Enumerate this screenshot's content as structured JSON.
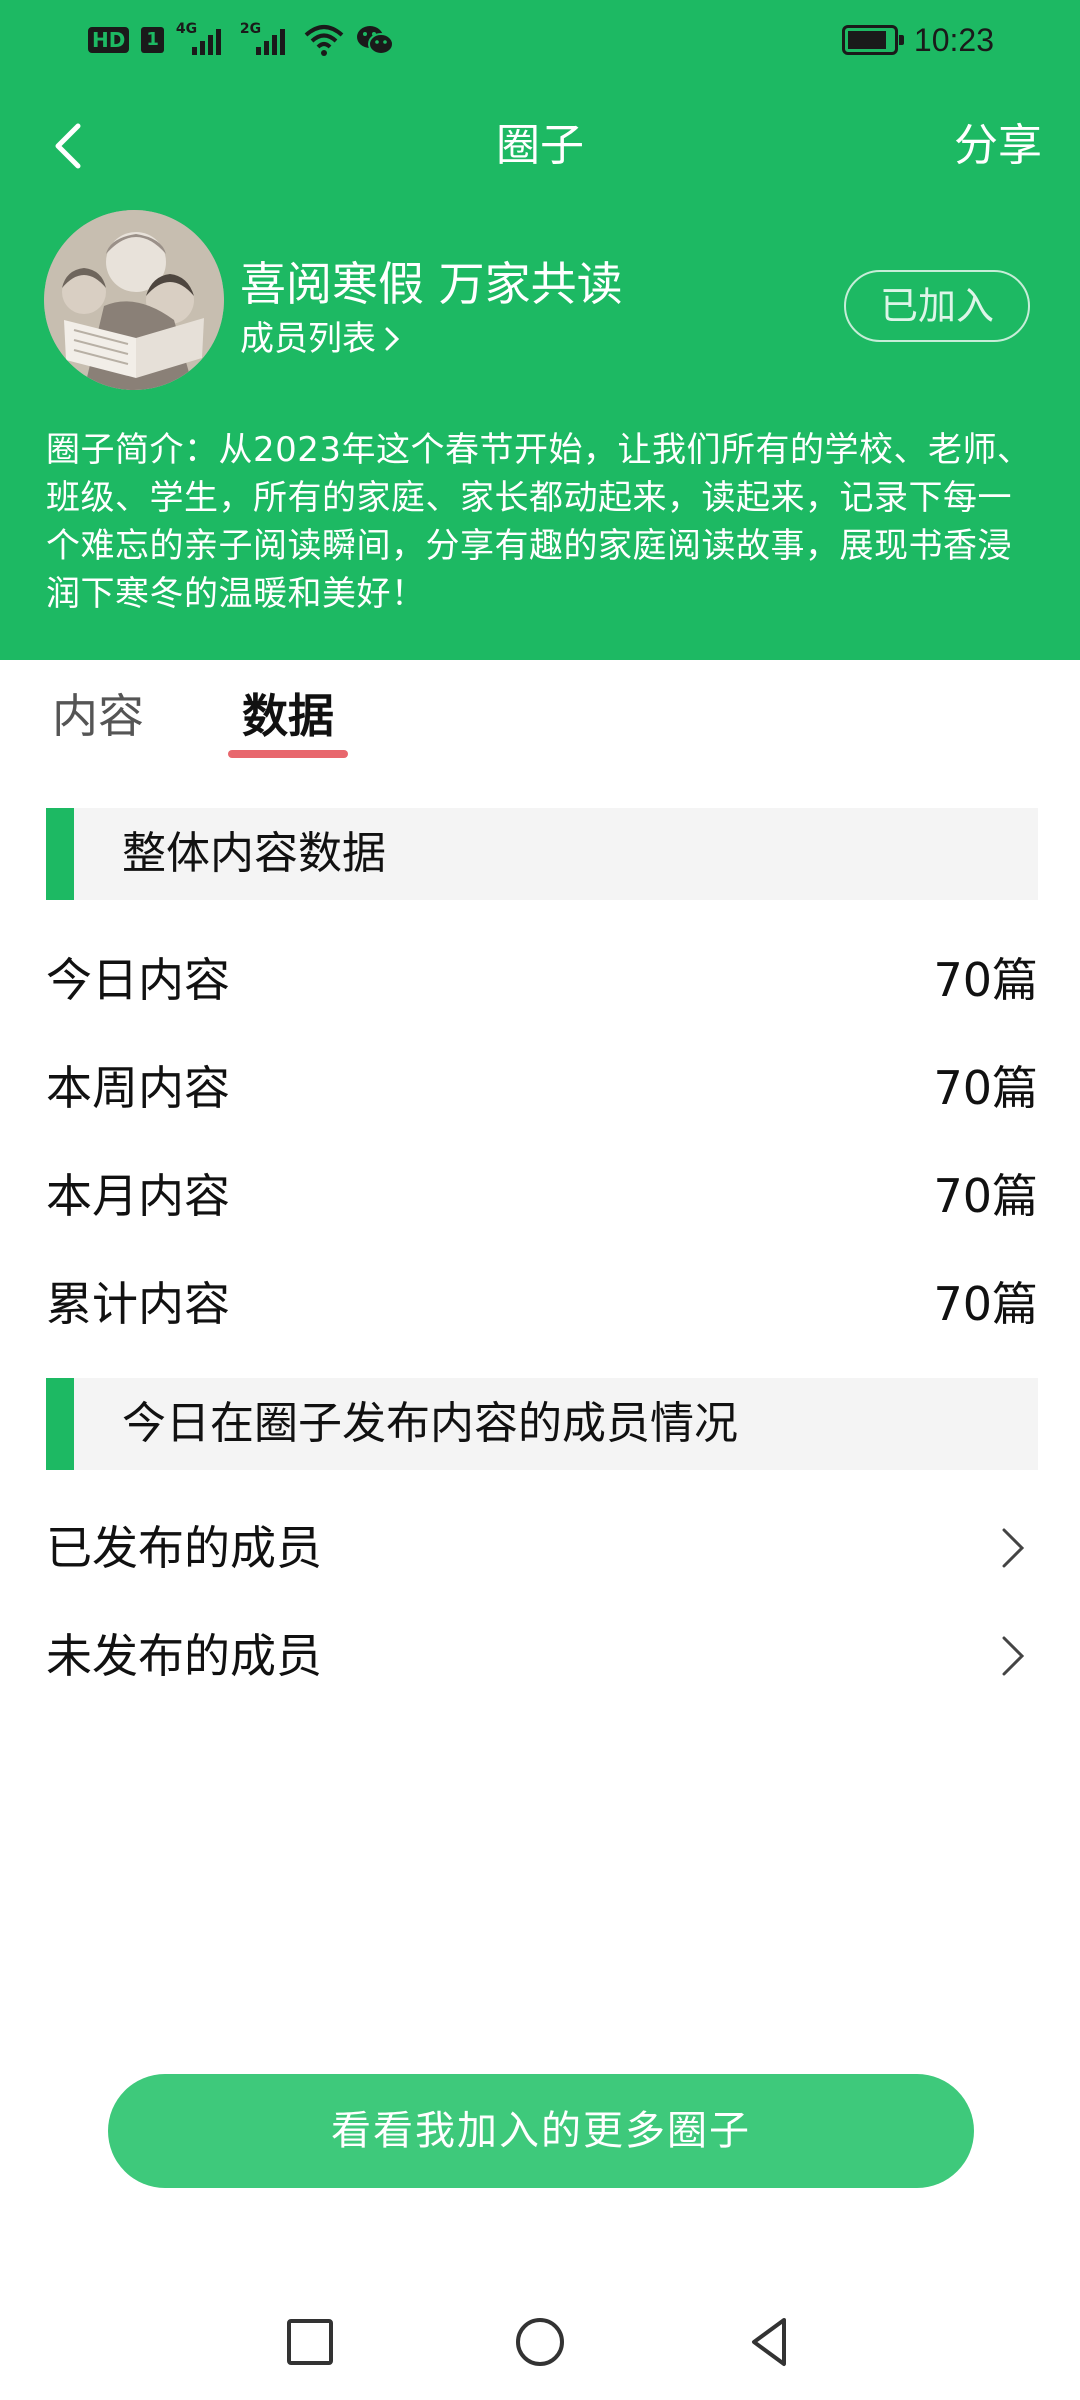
{
  "status_bar": {
    "hd_label": "HD",
    "sim_label": "1",
    "signal1_label": "4G",
    "signal2_label": "2G",
    "wifi_icon": "wifi-icon",
    "wechat_icon": "wechat-icon",
    "time": "10:23"
  },
  "navbar": {
    "title": "圈子",
    "share_label": "分享"
  },
  "group": {
    "name": "喜阅寒假 万家共读",
    "member_list_label": "成员列表",
    "joined_label": "已加入",
    "intro": "圈子简介：从2023年这个春节开始，让我们所有的学校、老师、班级、学生，所有的家庭、家长都动起来，读起来，记录下每一个难忘的亲子阅读瞬间，分享有趣的家庭阅读故事，展现书香浸润下寒冬的温暖和美好！"
  },
  "tabs": [
    {
      "label": "内容",
      "active": false
    },
    {
      "label": "数据",
      "active": true
    }
  ],
  "stats_section": {
    "title": "整体内容数据",
    "rows": [
      {
        "label": "今日内容",
        "value": "70篇"
      },
      {
        "label": "本周内容",
        "value": "70篇"
      },
      {
        "label": "本月内容",
        "value": "70篇"
      },
      {
        "label": "累计内容",
        "value": "70篇"
      }
    ]
  },
  "members_section": {
    "title": "今日在圈子发布内容的成员情况",
    "rows": [
      {
        "label": "已发布的成员"
      },
      {
        "label": "未发布的成员"
      }
    ]
  },
  "more_button_label": "看看我加入的更多圈子",
  "colors": {
    "primary_green": "#1db963",
    "button_green": "#3ec97b",
    "tab_indicator": "#e8676d",
    "section_bg": "#f4f4f4"
  }
}
